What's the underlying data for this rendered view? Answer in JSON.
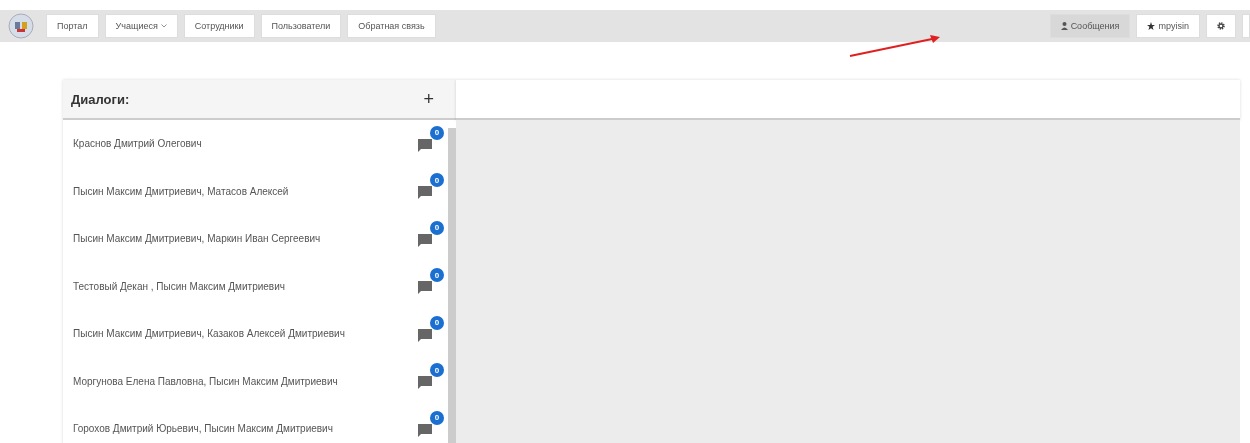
{
  "nav": {
    "items": [
      {
        "label": "Портал",
        "dropdown": false
      },
      {
        "label": "Учащиеся",
        "dropdown": true
      },
      {
        "label": "Сотрудники",
        "dropdown": false
      },
      {
        "label": "Пользователи",
        "dropdown": false
      },
      {
        "label": "Обратная связь",
        "dropdown": false
      }
    ],
    "right_items": [
      {
        "label": "Сообщения",
        "kind": "user",
        "selected": true
      },
      {
        "label": "mpyisin",
        "kind": "star",
        "selected": false
      },
      {
        "kind": "gear",
        "selected": false
      }
    ]
  },
  "dialogs": {
    "title": "Диалоги:",
    "add_button": "+",
    "items": [
      {
        "name": "Краснов Дмитрий Олегович",
        "unread": "0"
      },
      {
        "name": "Пысин Максим Дмитриевич, Матасов Алексей",
        "unread": "0"
      },
      {
        "name": "Пысин Максим Дмитриевич, Маркин Иван Сергеевич",
        "unread": "0"
      },
      {
        "name": "Тестовый Декан , Пысин Максим Дмитриевич",
        "unread": "0"
      },
      {
        "name": "Пысин Максим Дмитриевич, Казаков Алексей Дмитриевич",
        "unread": "0"
      },
      {
        "name": "Моргунова Елена Павловна, Пысин Максим Дмитриевич",
        "unread": "0"
      },
      {
        "name": "Горохов Дмитрий Юрьевич, Пысин Максим Дмитриевич",
        "unread": "0"
      }
    ]
  }
}
